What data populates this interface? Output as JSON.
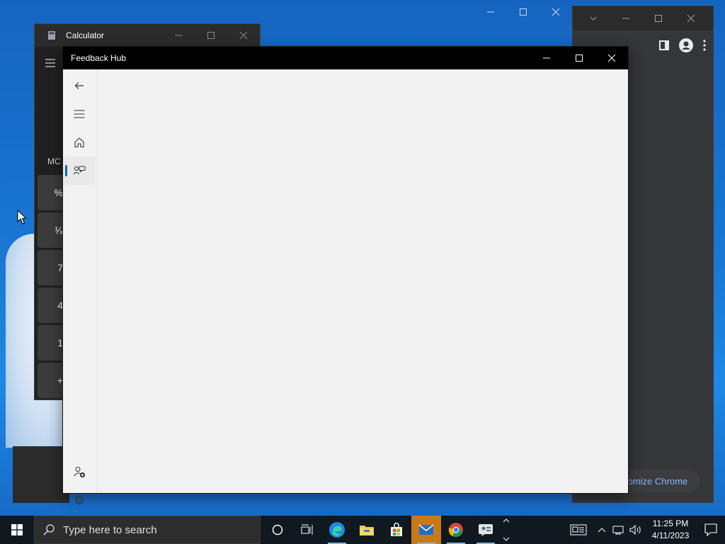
{
  "calculator": {
    "title": "Calculator",
    "memory_label": "MC",
    "keys": [
      "%",
      "¹⁄ₓ",
      "7",
      "4",
      "1",
      "+"
    ]
  },
  "feedback_hub": {
    "title": "Feedback Hub",
    "nav": {
      "back": "arrow-left-icon",
      "menu": "hamburger-icon",
      "home": "home-icon",
      "feedback": "feedback-icon",
      "add_account": "add-person-icon",
      "settings": "gear-icon"
    },
    "accent_color": "#0067c0"
  },
  "chrome": {
    "customize_label": "tomize Chrome"
  },
  "taskbar": {
    "search_placeholder": "Type here to search",
    "apps": [
      "cortana-icon",
      "task-view-icon",
      "edge-icon",
      "file-explorer-icon",
      "store-icon",
      "mail-icon",
      "chrome-icon",
      "feedback-hub-icon"
    ],
    "time": "11:25 PM",
    "date": "4/11/2023"
  },
  "colors": {
    "taskbar": "#101820",
    "titlebar_active": "#000000",
    "mail_active": "#c87a1a"
  }
}
